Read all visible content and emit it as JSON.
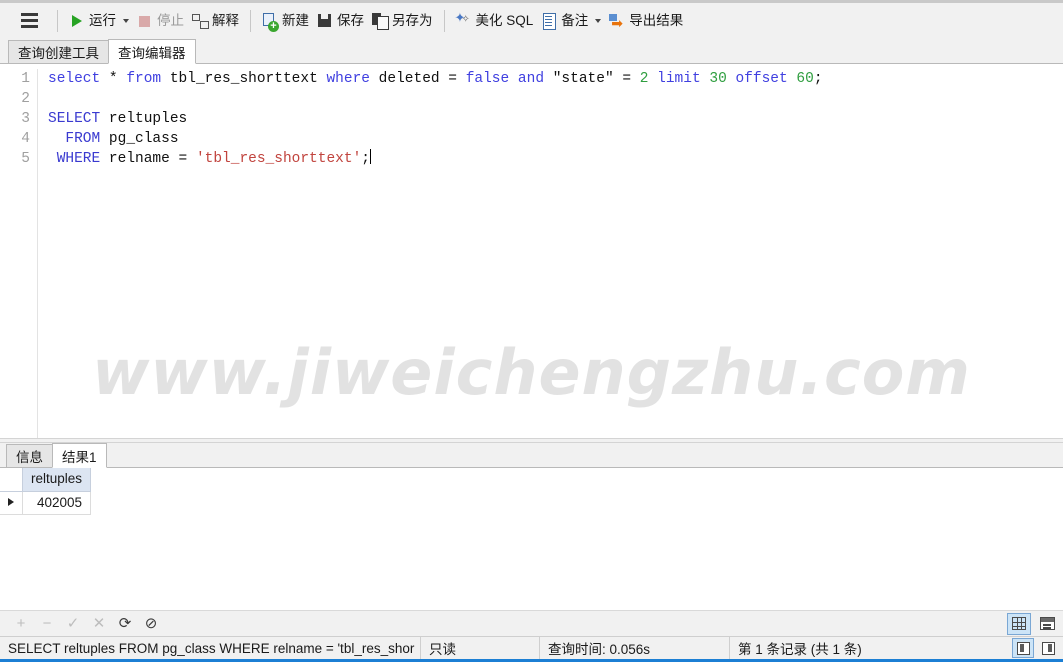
{
  "toolbar": {
    "menu_icon": "hamburger-menu-icon",
    "buttons": [
      {
        "id": "run",
        "label": "运行",
        "icon": "play-icon",
        "disabled": false,
        "caret": true
      },
      {
        "id": "stop",
        "label": "停止",
        "icon": "stop-square-icon",
        "disabled": true,
        "caret": false
      },
      {
        "id": "explain",
        "label": "解释",
        "icon": "explain-plan-icon",
        "disabled": false,
        "caret": false
      },
      {
        "id": "new",
        "label": "新建",
        "icon": "new-document-icon",
        "disabled": false,
        "caret": false
      },
      {
        "id": "save",
        "label": "保存",
        "icon": "floppy-disk-icon",
        "disabled": false,
        "caret": false
      },
      {
        "id": "save_as",
        "label": "另存为",
        "icon": "save-as-icon",
        "disabled": false,
        "caret": false
      },
      {
        "id": "beautify",
        "label": "美化 SQL",
        "icon": "magic-wand-icon",
        "disabled": false,
        "caret": false
      },
      {
        "id": "note",
        "label": "备注",
        "icon": "note-icon",
        "disabled": false,
        "caret": true
      },
      {
        "id": "export",
        "label": "导出结果",
        "icon": "export-arrow-icon",
        "disabled": false,
        "caret": false
      }
    ]
  },
  "editor_tabs": [
    {
      "label": "查询创建工具",
      "active": false
    },
    {
      "label": "查询编辑器",
      "active": true
    }
  ],
  "editor": {
    "watermark": "www.jiweichengzhu.com",
    "line_numbers": [
      "1",
      "2",
      "3",
      "4",
      "5"
    ],
    "lines": [
      [
        {
          "t": "select",
          "c": "k"
        },
        {
          "t": " * ",
          "c": "op"
        },
        {
          "t": "from",
          "c": "k"
        },
        {
          "t": " tbl_res_shorttext ",
          "c": "op"
        },
        {
          "t": "where",
          "c": "k"
        },
        {
          "t": " deleted = ",
          "c": "op"
        },
        {
          "t": "false",
          "c": "k"
        },
        {
          "t": " ",
          "c": "op"
        },
        {
          "t": "and",
          "c": "k"
        },
        {
          "t": " \"state\" = ",
          "c": "op"
        },
        {
          "t": "2",
          "c": "num"
        },
        {
          "t": " ",
          "c": "op"
        },
        {
          "t": "limit",
          "c": "k"
        },
        {
          "t": " ",
          "c": "op"
        },
        {
          "t": "30",
          "c": "num"
        },
        {
          "t": " ",
          "c": "op"
        },
        {
          "t": "offset",
          "c": "k"
        },
        {
          "t": " ",
          "c": "op"
        },
        {
          "t": "60",
          "c": "num"
        },
        {
          "t": ";",
          "c": "op"
        }
      ],
      [],
      [
        {
          "t": "SELECT",
          "c": "kd"
        },
        {
          "t": " reltuples",
          "c": "op"
        }
      ],
      [
        {
          "t": "  ",
          "c": "op"
        },
        {
          "t": "FROM",
          "c": "kd"
        },
        {
          "t": " pg_class",
          "c": "op"
        }
      ],
      [
        {
          "t": " ",
          "c": "op"
        },
        {
          "t": "WHERE",
          "c": "kd"
        },
        {
          "t": " relname = ",
          "c": "op"
        },
        {
          "t": "'tbl_res_shorttext'",
          "c": "str"
        },
        {
          "t": ";",
          "c": "op"
        }
      ]
    ]
  },
  "results": {
    "tabs": [
      {
        "label": "信息",
        "active": false
      },
      {
        "label": "结果1",
        "active": true
      }
    ],
    "columns": [
      "reltuples"
    ],
    "rows": [
      {
        "selected": true,
        "cells": [
          "402005"
        ]
      }
    ]
  },
  "record_bar": {
    "buttons": [
      {
        "id": "add",
        "glyph": "+",
        "icon": "plus-icon",
        "disabled": true
      },
      {
        "id": "remove",
        "glyph": "−",
        "icon": "minus-icon",
        "disabled": true
      },
      {
        "id": "apply",
        "glyph": "✓",
        "icon": "check-icon",
        "disabled": true
      },
      {
        "id": "discard",
        "glyph": "✕",
        "icon": "cross-icon",
        "disabled": true
      },
      {
        "id": "refresh",
        "glyph": "⟳",
        "icon": "refresh-icon",
        "disabled": false
      },
      {
        "id": "stop",
        "glyph": "⊘",
        "icon": "cancel-icon",
        "disabled": false
      }
    ],
    "view_toggles": [
      {
        "id": "grid_view",
        "icon": "grid-view-icon",
        "selected": true
      },
      {
        "id": "form_view",
        "icon": "form-view-icon",
        "selected": false
      }
    ]
  },
  "statusbar": {
    "sql": "SELECT reltuples  FROM pg_class  WHERE relname = 'tbl_res_shor",
    "readonly": "只读",
    "query_time": "查询时间: 0.056s",
    "record_info": "第 1 条记录 (共 1 条)",
    "panel_toggles": [
      {
        "id": "panel_left",
        "icon": "panel-left-icon",
        "selected": true
      },
      {
        "id": "panel_right",
        "icon": "panel-right-icon",
        "selected": false
      }
    ]
  },
  "colors": {
    "accent": "#1c7fd4",
    "keyword": "#4040e0",
    "string": "#c1443e",
    "number": "#2f9e3f",
    "header_bg": "#dce5f2",
    "selection": "#cce4f7"
  }
}
